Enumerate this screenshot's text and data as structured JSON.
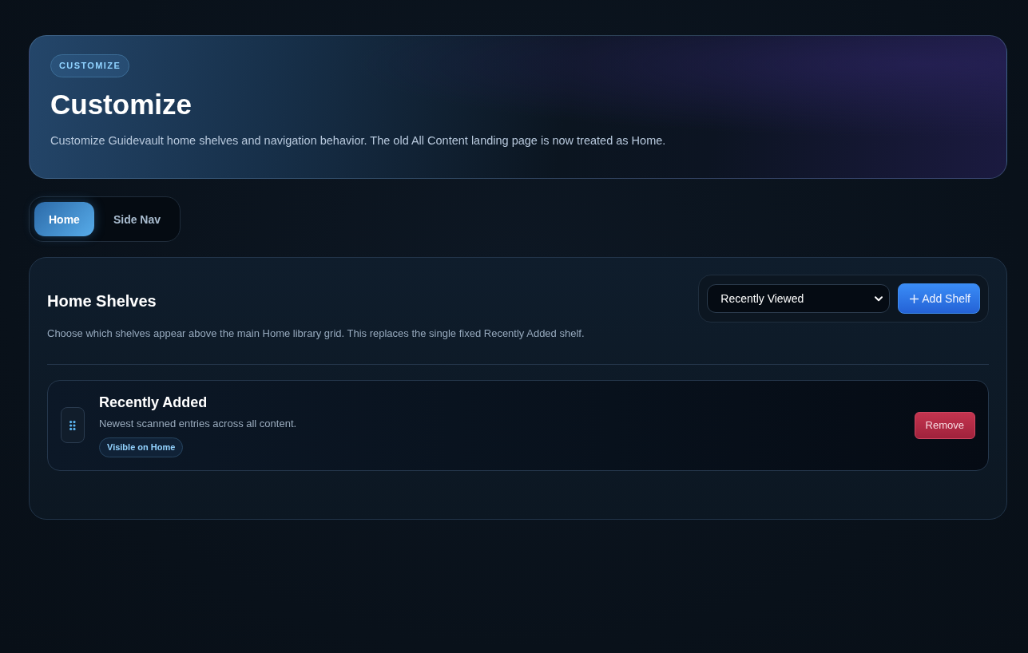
{
  "hero": {
    "badge": "CUSTOMIZE",
    "title": "Customize",
    "description": "Customize Guidevault home shelves and navigation behavior. The old All Content landing page is now treated as Home."
  },
  "tabs": [
    {
      "label": "Home",
      "selected": true
    },
    {
      "label": "Side Nav",
      "selected": false
    }
  ],
  "shelves_panel": {
    "title": "Home Shelves",
    "description": "Choose which shelves appear above the main Home library grid. This replaces the single fixed Recently Added shelf.",
    "shelf_select": {
      "value": "Recently Viewed"
    },
    "add_button": {
      "label": "Add Shelf"
    },
    "shelves": [
      {
        "title": "Recently Added",
        "description": "Newest scanned entries across all content.",
        "badge": "Visible on Home",
        "action": "Remove"
      }
    ]
  }
}
